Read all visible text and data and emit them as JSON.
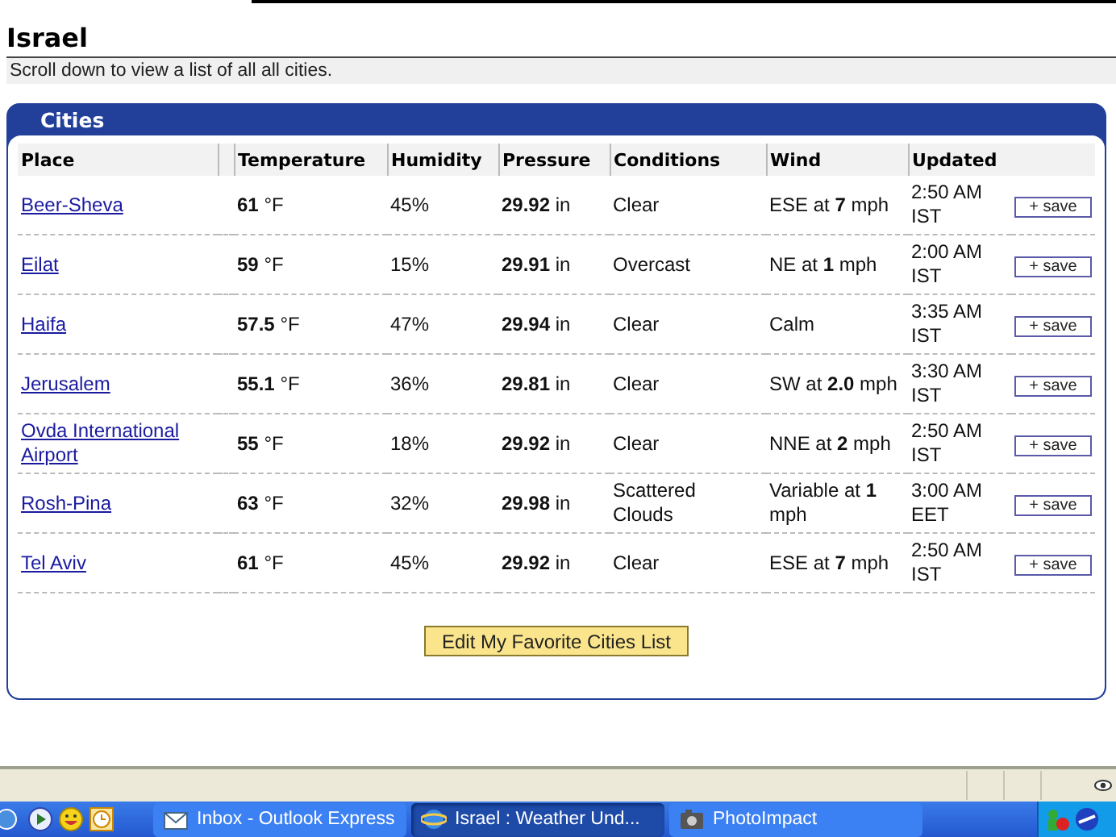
{
  "page": {
    "title": "Israel",
    "note": "Scroll down to view a list of all all cities."
  },
  "panel": {
    "title": "Cities",
    "columns": [
      "Place",
      "Temperature",
      "Humidity",
      "Pressure",
      "Conditions",
      "Wind",
      "Updated"
    ],
    "rows": [
      {
        "place": "Beer-Sheva",
        "temperature": "**61** °F",
        "humidity": "45%",
        "pressure": "**29.92** in",
        "conditions": "Clear",
        "wind": "ESE at **7** mph",
        "updated": "2:50 AM IST",
        "action": "+ save"
      },
      {
        "place": "Eilat",
        "temperature": "**59** °F",
        "humidity": "15%",
        "pressure": "**29.91** in",
        "conditions": "Overcast",
        "wind": "NE at **1** mph",
        "updated": "2:00 AM IST",
        "action": "+ save"
      },
      {
        "place": "Haifa",
        "temperature": "**57.5** °F",
        "humidity": "47%",
        "pressure": "**29.94** in",
        "conditions": "Clear",
        "wind": "Calm",
        "updated": "3:35 AM IST",
        "action": "+ save"
      },
      {
        "place": "Jerusalem",
        "temperature": "**55.1** °F",
        "humidity": "36%",
        "pressure": "**29.81** in",
        "conditions": "Clear",
        "wind": "SW at **2.0** mph",
        "updated": "3:30 AM IST",
        "action": "+ save"
      },
      {
        "place": "Ovda International Airport",
        "temperature": "**55** °F",
        "humidity": "18%",
        "pressure": "**29.92** in",
        "conditions": "Clear",
        "wind": "NNE at **2** mph",
        "updated": "2:50 AM IST",
        "action": "+ save"
      },
      {
        "place": "Rosh-Pina",
        "temperature": "**63** °F",
        "humidity": "32%",
        "pressure": "**29.98** in",
        "conditions": "Scattered Clouds",
        "wind": "Variable at **1** mph",
        "updated": "3:00 AM EET",
        "action": "+ save"
      },
      {
        "place": "Tel Aviv",
        "temperature": "**61** °F",
        "humidity": "45%",
        "pressure": "**29.92** in",
        "conditions": "Clear",
        "wind": "ESE at **7** mph",
        "updated": "2:50 AM IST",
        "action": "+ save"
      }
    ],
    "edit_button": "Edit My Favorite Cities List"
  },
  "taskbar": {
    "buttons": [
      {
        "label": "Inbox - Outlook Express",
        "selected": false,
        "kind": "mail"
      },
      {
        "label": "Israel : Weather Und...",
        "selected": true,
        "kind": "browser"
      },
      {
        "label": "PhotoImpact",
        "selected": false,
        "kind": "camera"
      }
    ]
  }
}
